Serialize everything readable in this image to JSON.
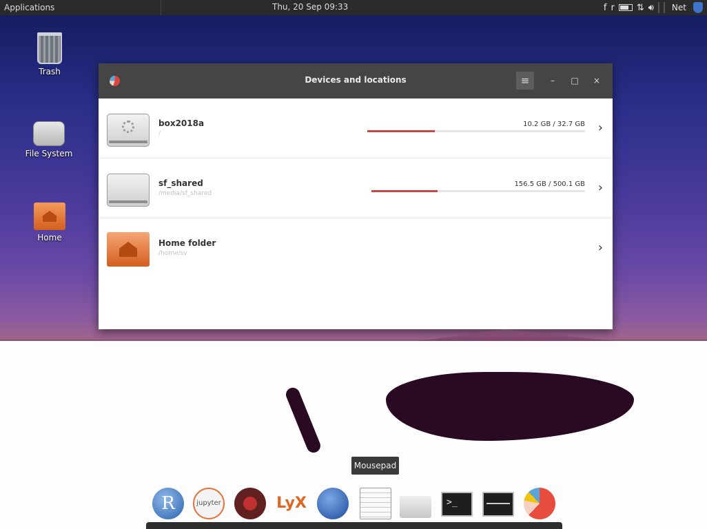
{
  "topbar": {
    "applications_label": "Applications",
    "clock": "Thu, 20 Sep  09:33",
    "tray": {
      "item1": "f",
      "item2": "r",
      "network_label": "Net"
    }
  },
  "desktop": {
    "icons": [
      {
        "label": "Trash",
        "icon": "trash-icon"
      },
      {
        "label": "File System",
        "icon": "drive-icon"
      },
      {
        "label": "Home",
        "icon": "home-folder-icon"
      }
    ]
  },
  "window": {
    "title": "Devices and locations",
    "menu_glyph": "≡",
    "minimize_glyph": "–",
    "maximize_glyph": "□",
    "close_glyph": "×",
    "locations": [
      {
        "name": "box2018a",
        "path": "/",
        "usage": "10.2 GB / 32.7 GB",
        "fraction": 0.31,
        "icon": "drive-icon"
      },
      {
        "name": "sf_shared",
        "path": "/media/sf_shared",
        "usage": "156.5 GB / 500.1 GB",
        "fraction": 0.31,
        "icon": "drive-icon"
      },
      {
        "name": "Home folder",
        "path": "/home/sv",
        "icon": "home-folder-icon"
      }
    ],
    "bar_color": "#c84848"
  },
  "tooltip": "Mousepad",
  "dock": {
    "items": [
      {
        "name": "r",
        "text": "R"
      },
      {
        "name": "jupyter",
        "text": "jupyter"
      },
      {
        "name": "spyder",
        "text": ""
      },
      {
        "name": "lyx",
        "text": "LyX"
      },
      {
        "name": "web-browser",
        "text": ""
      },
      {
        "name": "mousepad",
        "text": ""
      },
      {
        "name": "file-manager",
        "text": ""
      },
      {
        "name": "terminal",
        "text": ">_"
      },
      {
        "name": "system-monitor",
        "text": ""
      },
      {
        "name": "disk-usage",
        "text": ""
      }
    ]
  }
}
